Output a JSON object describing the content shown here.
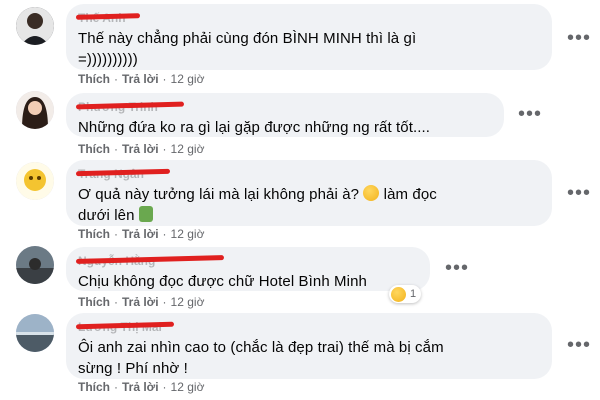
{
  "comments": [
    {
      "author": "Thế Anh",
      "text_lines": [
        "Thế này chẳng phải cùng đón BÌNH MINH thì là gì",
        "=))))))))))"
      ],
      "actions": {
        "like": "Thích",
        "reply": "Trả lời",
        "time": "12 giờ"
      },
      "more": "•••"
    },
    {
      "author": "Phương Trinh",
      "text_lines": [
        "Những đứa ko ra gì lại gặp được những ng rất tốt...."
      ],
      "actions": {
        "like": "Thích",
        "reply": "Trả lời",
        "time": "12 giờ"
      },
      "more": "•••"
    },
    {
      "author": "Trang Ngân",
      "text_lines": [
        "Ơ quả này tưởng lái mà lại không phải à?",
        "dưới lên"
      ],
      "text_suffix": "làm đọc",
      "emoji": [
        "sweat-smile-emoji",
        "zombie-emoji"
      ],
      "actions": {
        "like": "Thích",
        "reply": "Trả lời",
        "time": "12 giờ"
      },
      "more": "•••"
    },
    {
      "author": "Nguyễn Hằng",
      "text_lines": [
        "Chịu không đọc được chữ Hotel Bình Minh"
      ],
      "reaction": {
        "icon": "sad-reaction-emoji",
        "count": "1"
      },
      "actions": {
        "like": "Thích",
        "reply": "Trả lời",
        "time": "12 giờ"
      },
      "more": "•••"
    },
    {
      "author": "Lương Thị Mai",
      "text_lines": [
        "Ôi anh zai nhìn cao to (chắc là đẹp trai) thế mà bị cắm",
        "sừng ! Phí nhờ !"
      ],
      "actions": {
        "like": "Thích",
        "reply": "Trả lời",
        "time": "12 giờ"
      },
      "more": "•••"
    }
  ],
  "colors": {
    "bubble": "#f0f2f5",
    "scribble": "#e0201f",
    "muted": "#65676b"
  }
}
